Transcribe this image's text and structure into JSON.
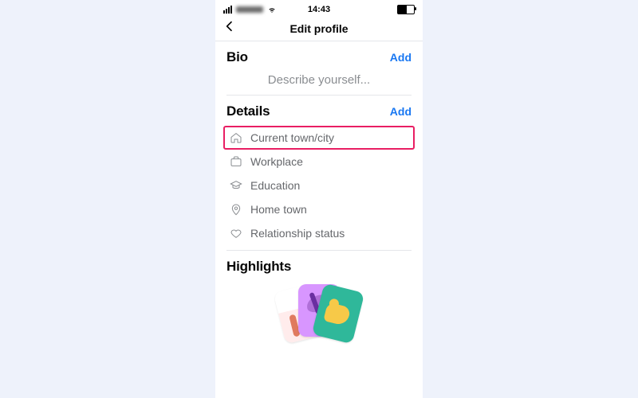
{
  "statusbar": {
    "time": "14:43"
  },
  "nav": {
    "title": "Edit profile"
  },
  "bio": {
    "title": "Bio",
    "add": "Add",
    "placeholder": "Describe yourself..."
  },
  "details": {
    "title": "Details",
    "add": "Add",
    "items": [
      {
        "icon": "home-icon",
        "label": "Current town/city",
        "highlight": true
      },
      {
        "icon": "briefcase-icon",
        "label": "Workplace",
        "highlight": false
      },
      {
        "icon": "education-icon",
        "label": "Education",
        "highlight": false
      },
      {
        "icon": "pin-icon",
        "label": "Home town",
        "highlight": false
      },
      {
        "icon": "heart-icon",
        "label": "Relationship status",
        "highlight": false
      }
    ]
  },
  "highlights": {
    "title": "Highlights"
  },
  "colors": {
    "link": "#1877f2",
    "highlight_border": "#e91e63",
    "muted": "#65676b"
  }
}
